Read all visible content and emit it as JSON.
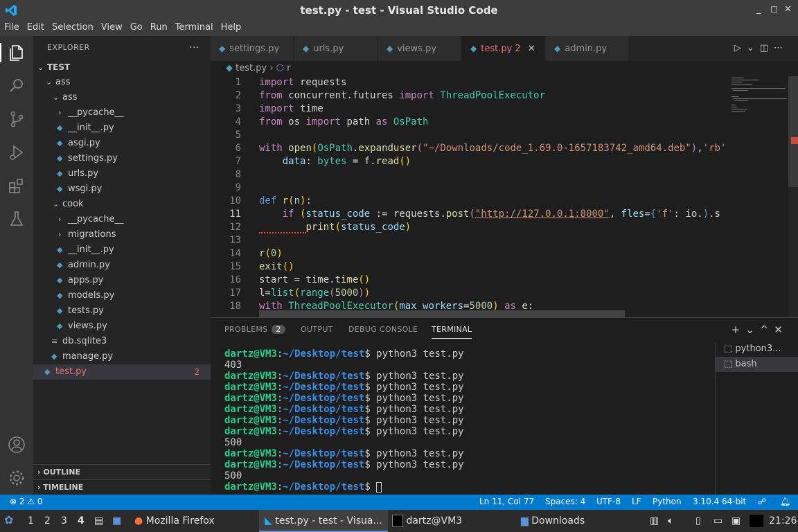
{
  "window": {
    "title": "test.py - test - Visual Studio Code",
    "controls": [
      "_",
      "◻",
      "✕"
    ]
  },
  "menu": [
    "File",
    "Edit",
    "Selection",
    "View",
    "Go",
    "Run",
    "Terminal",
    "Help"
  ],
  "explorer": {
    "title": "EXPLORER",
    "more": "···",
    "root": "TEST",
    "items": [
      {
        "label": "ass",
        "type": "folder-open"
      },
      {
        "label": "ass",
        "type": "folder-open"
      },
      {
        "label": "__pycache__",
        "type": "folder"
      },
      {
        "label": "__init__.py",
        "type": "py"
      },
      {
        "label": "asgi.py",
        "type": "py"
      },
      {
        "label": "settings.py",
        "type": "py"
      },
      {
        "label": "urls.py",
        "type": "py"
      },
      {
        "label": "wsgi.py",
        "type": "py"
      },
      {
        "label": "cook",
        "type": "folder-open"
      },
      {
        "label": "__pycache__",
        "type": "folder"
      },
      {
        "label": "migrations",
        "type": "folder"
      },
      {
        "label": "__init__.py",
        "type": "py"
      },
      {
        "label": "admin.py",
        "type": "py"
      },
      {
        "label": "apps.py",
        "type": "py"
      },
      {
        "label": "models.py",
        "type": "py"
      },
      {
        "label": "tests.py",
        "type": "py"
      },
      {
        "label": "views.py",
        "type": "py"
      },
      {
        "label": "db.sqlite3",
        "type": "db"
      },
      {
        "label": "manage.py",
        "type": "py"
      },
      {
        "label": "test.py",
        "type": "py",
        "badge": "2"
      }
    ],
    "outline": "OUTLINE",
    "timeline": "TIMELINE"
  },
  "tabs": [
    {
      "label": "settings.py"
    },
    {
      "label": "urls.py"
    },
    {
      "label": "views.py"
    },
    {
      "label": "test.py",
      "badge": "2",
      "close": "✕"
    },
    {
      "label": "admin.py"
    }
  ],
  "breadcrumb": {
    "file": "test.py",
    "sep": "›",
    "symbol": "r"
  },
  "code_line_numbers": [
    "1",
    "2",
    "3",
    "4",
    "5",
    "6",
    "7",
    "8",
    "9",
    "10",
    "11",
    "12",
    "13",
    "14",
    "15",
    "16",
    "17",
    "18"
  ],
  "panel": {
    "tabs": {
      "problems": "PROBLEMS",
      "problems_count": "2",
      "output": "OUTPUT",
      "debug": "DEBUG CONSOLE",
      "terminal": "TERMINAL"
    },
    "terminal_lines": [
      {
        "prompt": true,
        "cmd": " python3 test.py"
      },
      {
        "prompt": false,
        "out": "403"
      },
      {
        "prompt": true,
        "cmd": " python3 test.py"
      },
      {
        "prompt": true,
        "cmd": " python3 test.py"
      },
      {
        "prompt": true,
        "cmd": " python3 test.py"
      },
      {
        "prompt": true,
        "cmd": " python3 test.py"
      },
      {
        "prompt": true,
        "cmd": " python3 test.py"
      },
      {
        "prompt": true,
        "cmd": " python3 test.py"
      },
      {
        "prompt": false,
        "out": "500"
      },
      {
        "prompt": true,
        "cmd": " python3 test.py"
      },
      {
        "prompt": true,
        "cmd": " python3 test.py"
      },
      {
        "prompt": false,
        "out": "500"
      },
      {
        "prompt": true,
        "cmd": " "
      }
    ],
    "prompt_user": "dartz@VM3",
    "prompt_path": "~/Desktop/test",
    "terminal_list": [
      "python3...",
      "bash"
    ]
  },
  "status": {
    "errors": "⊗ 2 ⚠ 0",
    "position": "Ln 11, Col 77",
    "spaces": "Spaces: 4",
    "encoding": "UTF-8",
    "eol": "LF",
    "language": "Python",
    "interpreter": "3.10.4 64-bit"
  },
  "taskbar": {
    "workspaces": [
      "1",
      "2",
      "3",
      "4"
    ],
    "windows": [
      "Mozilla Firefox",
      "test.py - test - Visua...",
      "dartz@VM3",
      "Downloads"
    ],
    "clock": "21:26"
  },
  "colors": {
    "accent": "#007acc",
    "error": "#e57373",
    "prompt_user": "#23d18b",
    "prompt_path": "#3b8eea"
  }
}
